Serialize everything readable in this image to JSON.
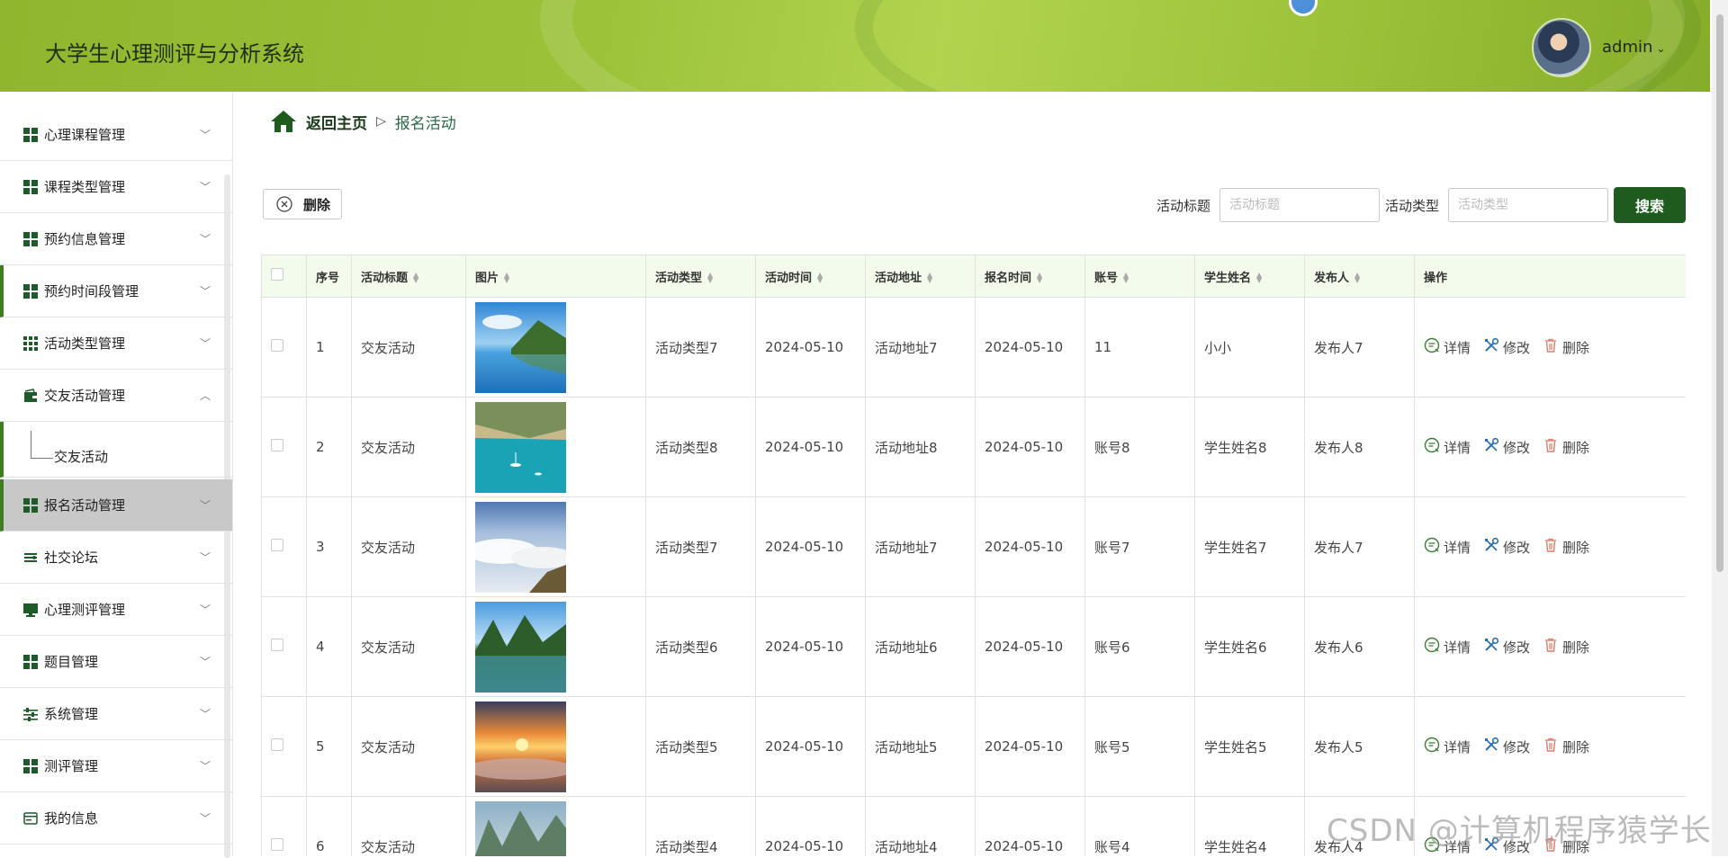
{
  "header": {
    "title": "大学生心理测评与分析系统",
    "username": "admin"
  },
  "sidebar": {
    "items": [
      {
        "label": "心理课程管理",
        "icon": "grid-icon"
      },
      {
        "label": "课程类型管理",
        "icon": "grid-icon"
      },
      {
        "label": "预约信息管理",
        "icon": "grid-icon"
      },
      {
        "label": "预约时间段管理",
        "icon": "grid-icon"
      },
      {
        "label": "活动类型管理",
        "icon": "grid-3x3-icon"
      },
      {
        "label": "交友活动管理",
        "icon": "wallet-icon"
      },
      {
        "label": "交友活动",
        "icon": "tree-line-icon"
      },
      {
        "label": "报名活动管理",
        "icon": "grid-icon"
      },
      {
        "label": "社交论坛",
        "icon": "list-icon"
      },
      {
        "label": "心理测评管理",
        "icon": "monitor-icon"
      },
      {
        "label": "题目管理",
        "icon": "grid-icon"
      },
      {
        "label": "系统管理",
        "icon": "sliders-icon"
      },
      {
        "label": "测评管理",
        "icon": "grid-icon"
      },
      {
        "label": "我的信息",
        "icon": "card-icon"
      }
    ]
  },
  "breadcrumb": {
    "home": "返回主页",
    "current": "报名活动"
  },
  "toolbar": {
    "delete_label": "删除",
    "search_title_label": "活动标题",
    "search_title_placeholder": "活动标题",
    "search_type_label": "活动类型",
    "search_type_placeholder": "活动类型",
    "search_button": "搜索"
  },
  "table": {
    "headers": [
      "序号",
      "活动标题",
      "图片",
      "活动类型",
      "活动时间",
      "活动地址",
      "报名时间",
      "账号",
      "学生姓名",
      "发布人",
      "操作"
    ],
    "actions": {
      "detail": "详情",
      "edit": "修改",
      "delete": "删除"
    },
    "rows": [
      {
        "no": "1",
        "title": "交友活动",
        "image": "lake-mountain",
        "type": "活动类型7",
        "time": "2024-05-10",
        "address": "活动地址7",
        "signup": "2024-05-10",
        "account": "11",
        "student": "小小",
        "publisher": "发布人7"
      },
      {
        "no": "2",
        "title": "交友活动",
        "image": "turquoise-bay",
        "type": "活动类型8",
        "time": "2024-05-10",
        "address": "活动地址8",
        "signup": "2024-05-10",
        "account": "账号8",
        "student": "学生姓名8",
        "publisher": "发布人8"
      },
      {
        "no": "3",
        "title": "交友活动",
        "image": "sea-of-clouds",
        "type": "活动类型7",
        "time": "2024-05-10",
        "address": "活动地址7",
        "signup": "2024-05-10",
        "account": "账号7",
        "student": "学生姓名7",
        "publisher": "发布人7"
      },
      {
        "no": "4",
        "title": "交友活动",
        "image": "forest-lake",
        "type": "活动类型6",
        "time": "2024-05-10",
        "address": "活动地址6",
        "signup": "2024-05-10",
        "account": "账号6",
        "student": "学生姓名6",
        "publisher": "发布人6"
      },
      {
        "no": "5",
        "title": "交友活动",
        "image": "sunset-clouds",
        "type": "活动类型5",
        "time": "2024-05-10",
        "address": "活动地址5",
        "signup": "2024-05-10",
        "account": "账号5",
        "student": "学生姓名5",
        "publisher": "发布人5"
      },
      {
        "no": "6",
        "title": "交友活动",
        "image": "misty-karst",
        "type": "活动类型4",
        "time": "2024-05-10",
        "address": "活动地址4",
        "signup": "2024-05-10",
        "account": "账号4",
        "student": "学生姓名4",
        "publisher": "发布人4"
      }
    ]
  },
  "watermark": "CSDN @计算机程序猿学长",
  "colors": {
    "accent": "#1f5a1f",
    "header": "#9cc23a",
    "table_header": "#f2fbec",
    "delete_icon": "#e07a6a"
  }
}
